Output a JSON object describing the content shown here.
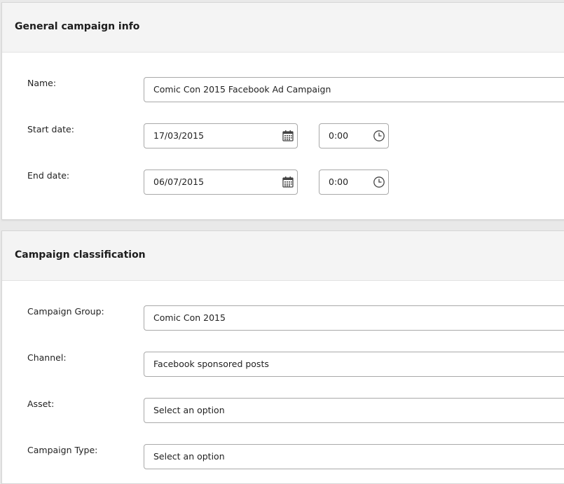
{
  "general": {
    "title": "General campaign info",
    "name_label": "Name:",
    "name_value": "Comic Con 2015 Facebook Ad Campaign",
    "start_label": "Start date:",
    "start_date": "17/03/2015",
    "start_time": "0:00",
    "end_label": "End date:",
    "end_date": "06/07/2015",
    "end_time": "0:00"
  },
  "classification": {
    "title": "Campaign classification",
    "group_label": "Campaign Group:",
    "group_value": "Comic Con 2015",
    "channel_label": "Channel:",
    "channel_value": "Facebook sponsored posts",
    "asset_label": "Asset:",
    "asset_value": "Select an option",
    "type_label": "Campaign Type:",
    "type_value": "Select an option"
  },
  "icons": {
    "date": "calendar-icon",
    "time": "clock-icon"
  }
}
